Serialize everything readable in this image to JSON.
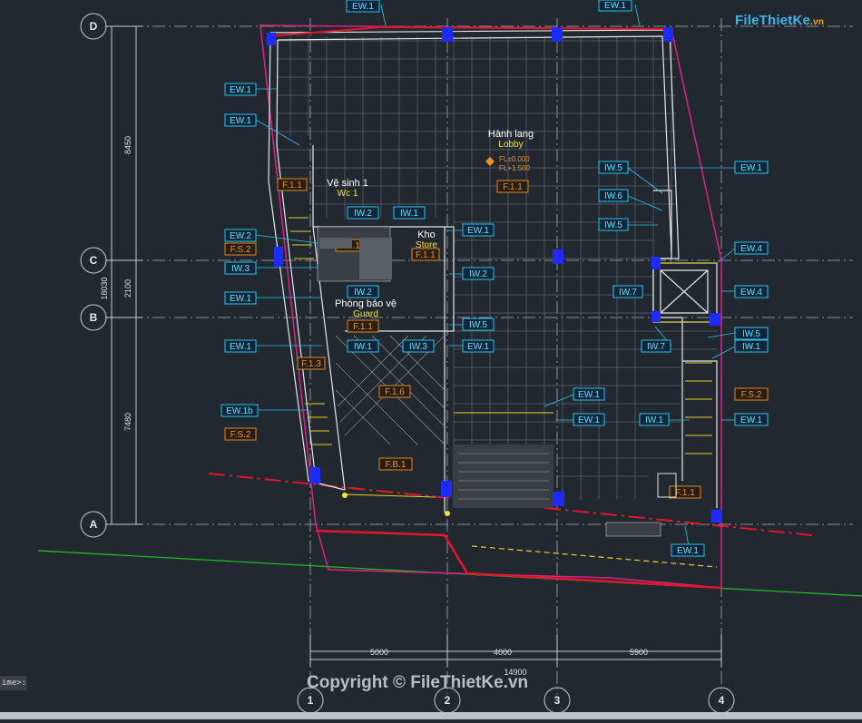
{
  "logo": {
    "brand": "FileThietKe",
    "suffix": ".vn"
  },
  "watermark": "Copyright © FileThietKe.vn",
  "command_line": "ime>:",
  "grid": {
    "rows": [
      "D",
      "C",
      "B",
      "A"
    ],
    "cols": [
      "1",
      "2",
      "3",
      "4"
    ]
  },
  "dimensions": {
    "vertical": [
      "8450",
      "2100",
      "7480",
      "18030"
    ],
    "horizontal": [
      "5000",
      "4000",
      "5900",
      "14900"
    ]
  },
  "rooms": [
    {
      "vi": "Hành lang",
      "en": "Lobby",
      "tag": "F.1.1",
      "level1": "FL±0.000",
      "level2": "FL+1.500"
    },
    {
      "vi": "Vệ sinh 1",
      "en": "Wc 1",
      "tag": "F.1.1"
    },
    {
      "vi": "Kho",
      "en": "Store",
      "tag": "F.1.1"
    },
    {
      "vi": "Phòng bảo vệ",
      "en": "Guard",
      "tag": "F.1.1"
    }
  ],
  "cyan_tags": [
    "EW.1",
    "EW.1",
    "EW.1",
    "EW.2",
    "IW.3",
    "EW.1",
    "EW.1",
    "EW.1b",
    "IW.2",
    "IW.1",
    "EW.1",
    "IW.2",
    "IW.2",
    "IW.5",
    "IW.1",
    "IW.3",
    "EW.1",
    "EW.1",
    "EW.1",
    "IW.5",
    "IW.6",
    "IW.5",
    "EW.1",
    "EW.4",
    "IW.7",
    "EW.4",
    "IW.7",
    "IW.5",
    "IW.1",
    "IW.1",
    "EW.1",
    "EW.1",
    "EW.1"
  ],
  "orange_tags": [
    "F.1.1",
    "F.S.2",
    "F.1.3",
    "F.S.2",
    "F.1.6",
    "F.B.1",
    "F.1.1",
    "F.1.1",
    "F.1.1",
    "F.1.1",
    "F.S.2",
    "F.1.1"
  ]
}
